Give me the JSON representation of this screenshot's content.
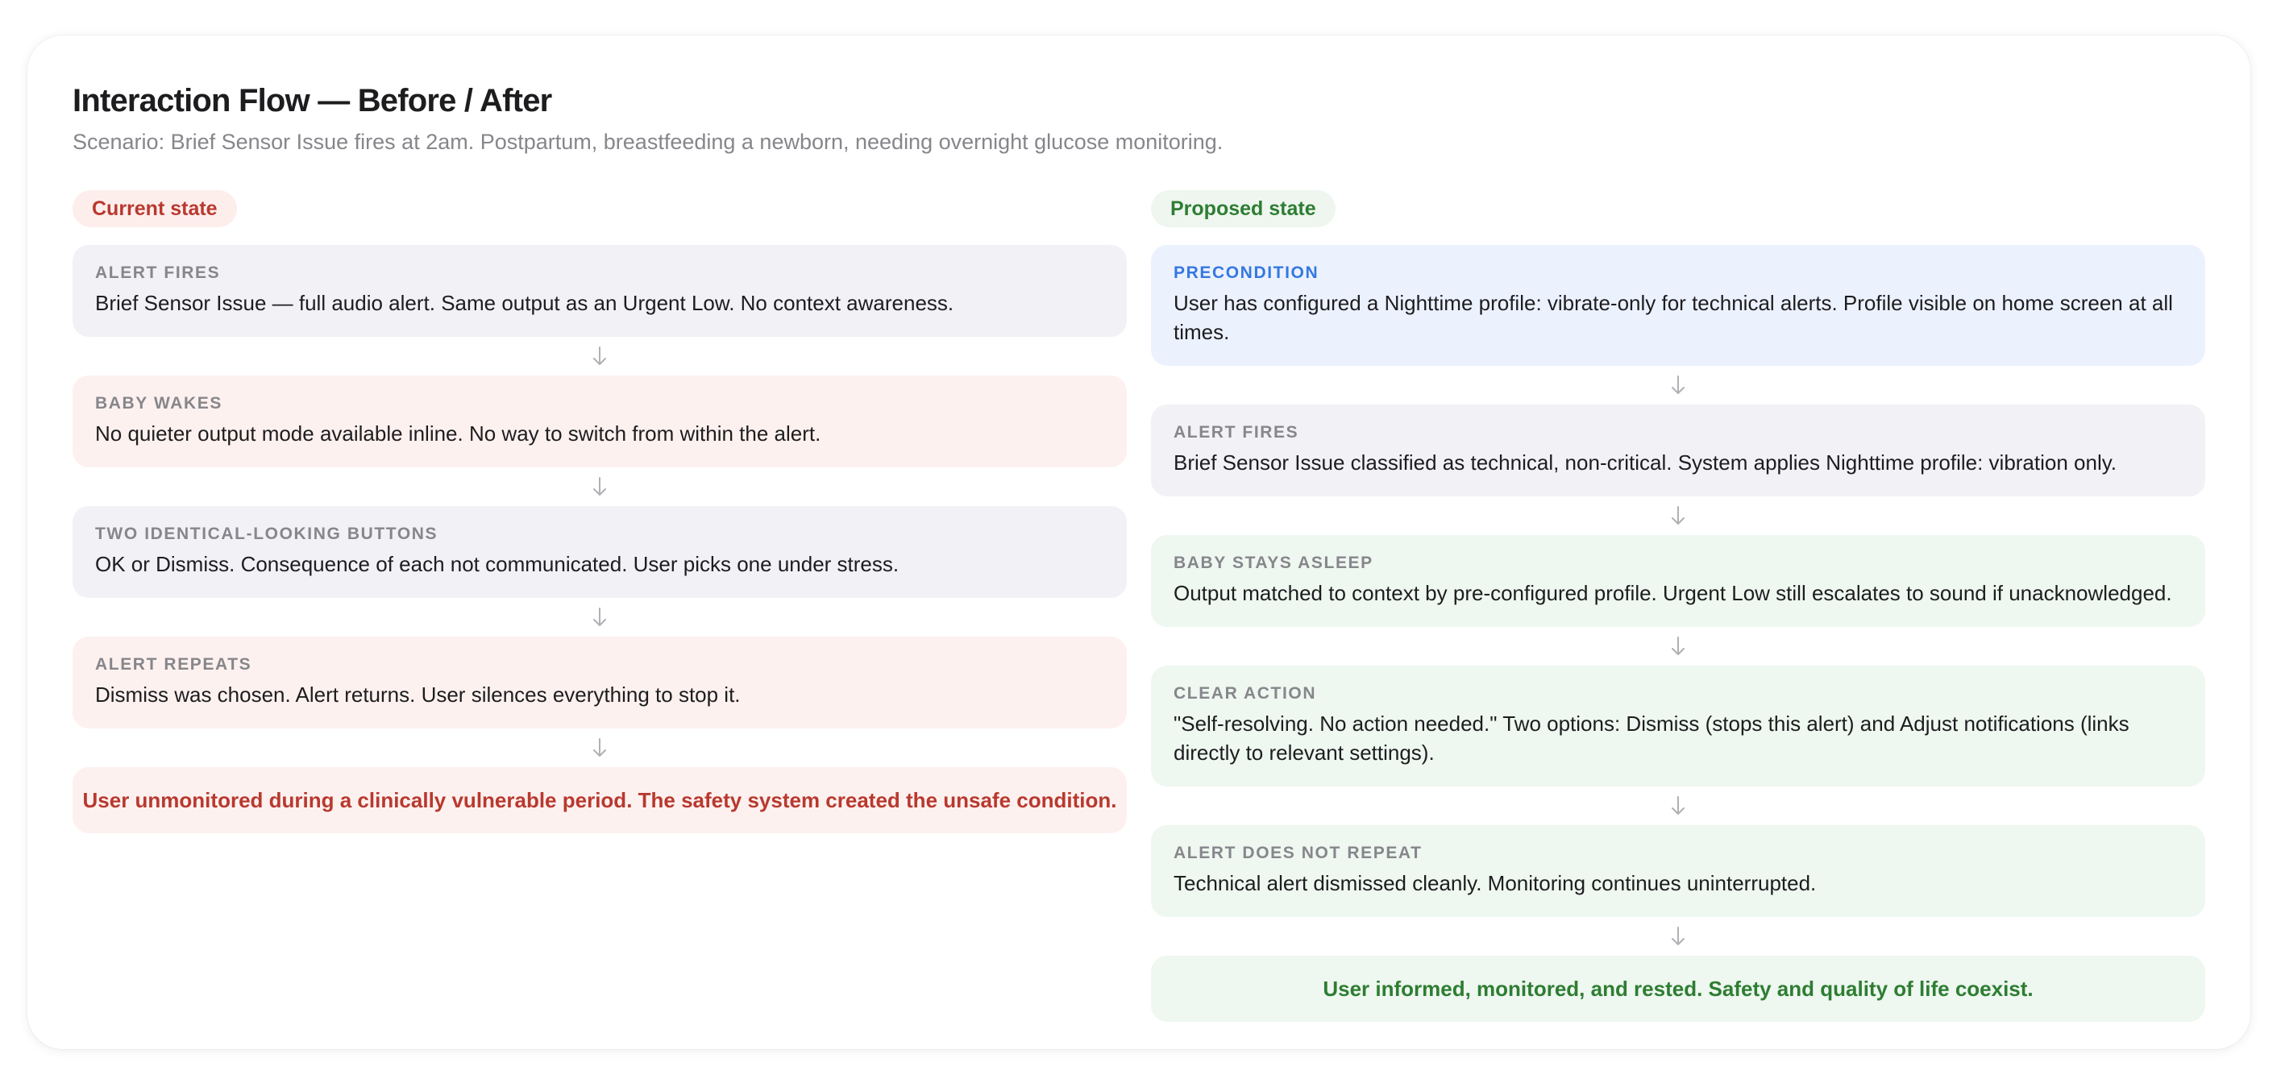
{
  "header": {
    "title": "Interaction Flow — Before / After",
    "subtitle": "Scenario: Brief Sensor Issue fires at 2am. Postpartum, breastfeeding a newborn, needing overnight glucose monitoring."
  },
  "current": {
    "pill": "Current state",
    "steps": [
      {
        "label": "ALERT FIRES",
        "text": "Brief Sensor Issue — full audio alert. Same output as an Urgent Low. No context awareness."
      },
      {
        "label": "BABY WAKES",
        "text": "No quieter output mode available inline. No way to switch from within the alert."
      },
      {
        "label": "TWO IDENTICAL-LOOKING BUTTONS",
        "text": "OK or Dismiss. Consequence of each not communicated. User picks one under stress."
      },
      {
        "label": "ALERT REPEATS",
        "text": "Dismiss was chosen. Alert returns. User silences everything to stop it."
      }
    ],
    "outcome": "User unmonitored during a clinically vulnerable period. The safety system created the unsafe condition."
  },
  "proposed": {
    "pill": "Proposed state",
    "steps": [
      {
        "label": "PRECONDITION",
        "text": "User has configured a Nighttime profile: vibrate-only for technical alerts. Profile visible on home screen at all times."
      },
      {
        "label": "ALERT FIRES",
        "text": "Brief Sensor Issue classified as technical, non-critical. System applies Nighttime profile: vibration only."
      },
      {
        "label": "BABY STAYS ASLEEP",
        "text": "Output matched to context by pre-configured profile. Urgent Low still escalates to sound if unacknowledged."
      },
      {
        "label": "CLEAR ACTION",
        "text": "\"Self-resolving. No action needed.\" Two options: Dismiss (stops this alert) and Adjust notifications (links directly to relevant settings)."
      },
      {
        "label": "ALERT DOES NOT REPEAT",
        "text": "Technical alert dismissed cleanly. Monitoring continues uninterrupted."
      }
    ],
    "outcome": "User informed, monitored, and rested. Safety and quality of life coexist."
  },
  "colors": {
    "current_accent": "#b8392f",
    "proposed_accent": "#2e7d32",
    "precondition_label": "#3478e0",
    "arrow": "#b0b0b5"
  }
}
